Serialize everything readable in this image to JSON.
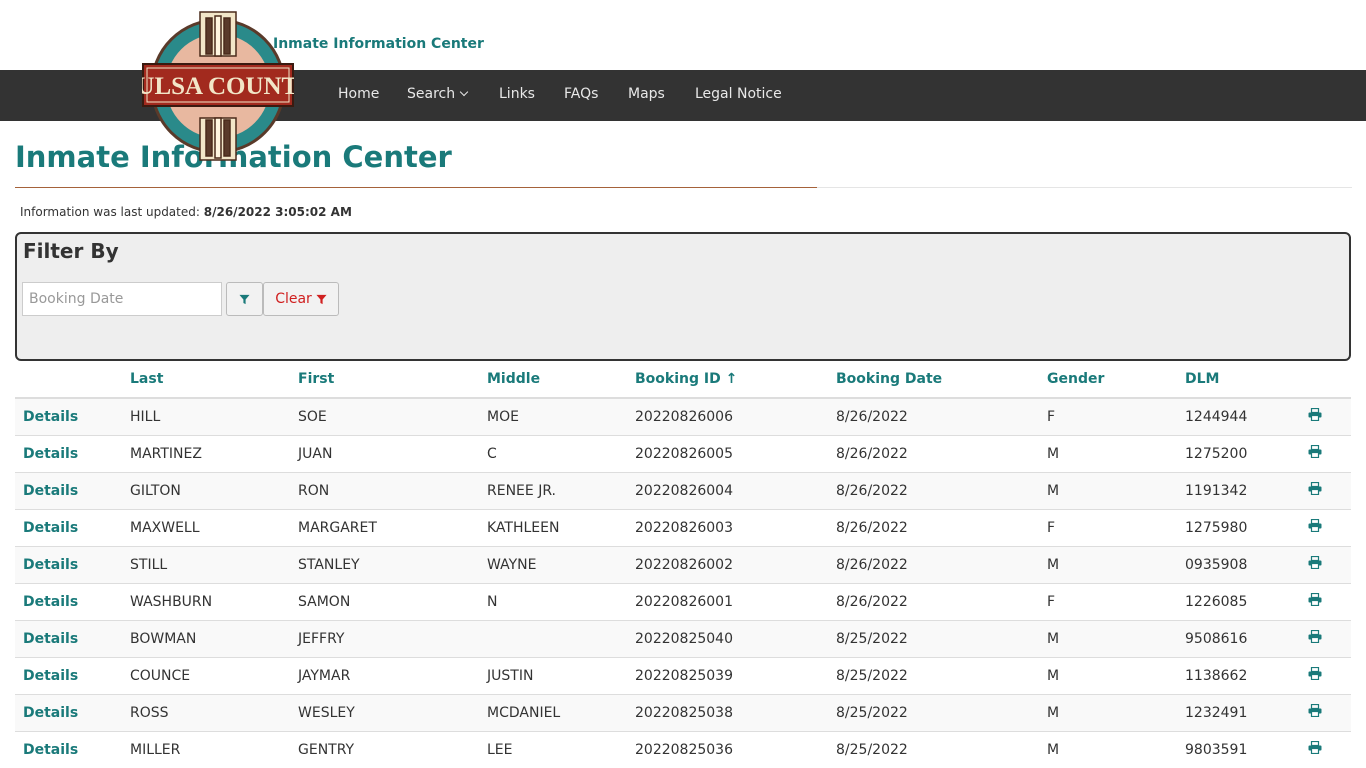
{
  "header": {
    "site_name": "Inmate Information Center",
    "logo_text": "TULSA COUNTY"
  },
  "nav": {
    "items": [
      {
        "label": "Home"
      },
      {
        "label": "Search"
      },
      {
        "label": "Links"
      },
      {
        "label": "FAQs"
      },
      {
        "label": "Maps"
      },
      {
        "label": "Legal Notice"
      }
    ]
  },
  "page": {
    "title": "Inmate Information Center",
    "updated_label": "Information was last updated:",
    "updated_value": "8/26/2022 3:05:02 AM"
  },
  "filter": {
    "title": "Filter By",
    "date_placeholder": "Booking Date",
    "clear_label": "Clear"
  },
  "table": {
    "columns": [
      "",
      "Last",
      "First",
      "Middle",
      "Booking ID ↑",
      "Booking Date",
      "Gender",
      "DLM",
      ""
    ],
    "details_label": "Details",
    "rows": [
      {
        "last": "HILL",
        "first": "SOE",
        "middle": "MOE",
        "booking_id": "20220826006",
        "booking_date": "8/26/2022",
        "gender": "F",
        "dlm": "1244944"
      },
      {
        "last": "MARTINEZ",
        "first": "JUAN",
        "middle": "C",
        "booking_id": "20220826005",
        "booking_date": "8/26/2022",
        "gender": "M",
        "dlm": "1275200"
      },
      {
        "last": "GILTON",
        "first": "RON",
        "middle": "RENEE JR.",
        "booking_id": "20220826004",
        "booking_date": "8/26/2022",
        "gender": "M",
        "dlm": "1191342"
      },
      {
        "last": "MAXWELL",
        "first": "MARGARET",
        "middle": "KATHLEEN",
        "booking_id": "20220826003",
        "booking_date": "8/26/2022",
        "gender": "F",
        "dlm": "1275980"
      },
      {
        "last": "STILL",
        "first": "STANLEY",
        "middle": "WAYNE",
        "booking_id": "20220826002",
        "booking_date": "8/26/2022",
        "gender": "M",
        "dlm": "0935908"
      },
      {
        "last": "WASHBURN",
        "first": "SAMON",
        "middle": "N",
        "booking_id": "20220826001",
        "booking_date": "8/26/2022",
        "gender": "F",
        "dlm": "1226085"
      },
      {
        "last": "BOWMAN",
        "first": "JEFFRY",
        "middle": "",
        "booking_id": "20220825040",
        "booking_date": "8/25/2022",
        "gender": "M",
        "dlm": "9508616"
      },
      {
        "last": "COUNCE",
        "first": "JAYMAR",
        "middle": "JUSTIN",
        "booking_id": "20220825039",
        "booking_date": "8/25/2022",
        "gender": "M",
        "dlm": "1138662"
      },
      {
        "last": "ROSS",
        "first": "WESLEY",
        "middle": "MCDANIEL",
        "booking_id": "20220825038",
        "booking_date": "8/25/2022",
        "gender": "M",
        "dlm": "1232491"
      },
      {
        "last": "MILLER",
        "first": "GENTRY",
        "middle": "LEE",
        "booking_id": "20220825036",
        "booking_date": "8/25/2022",
        "gender": "M",
        "dlm": "9803591"
      }
    ]
  },
  "colors": {
    "accent": "#1a7a7a",
    "navbar": "#333333",
    "clear": "#d02020",
    "rule": "#a5623a"
  },
  "icons": {
    "filter": "funnel-icon",
    "print": "printer-icon",
    "dropdown": "chevron-down-icon"
  }
}
